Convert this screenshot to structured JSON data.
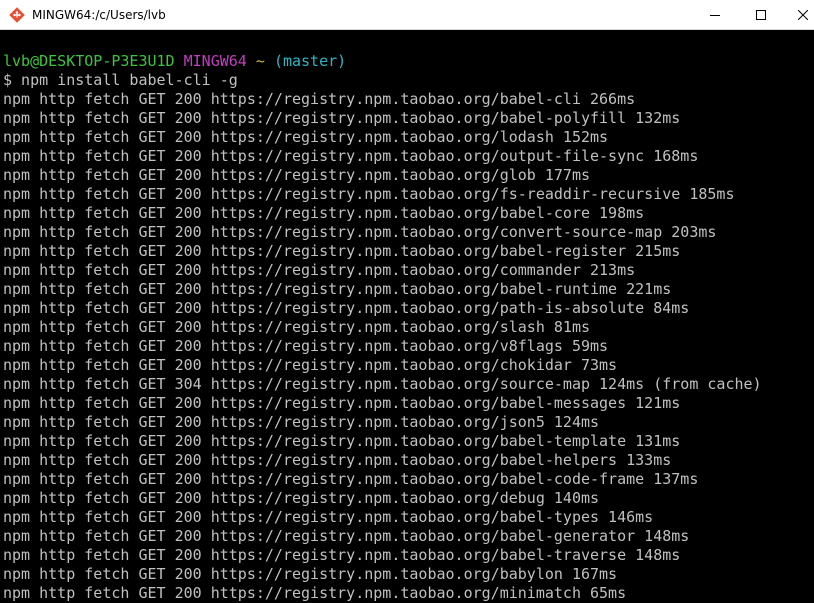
{
  "window": {
    "title": "MINGW64:/c/Users/lvb",
    "icon": "git-bash-icon",
    "controls": {
      "minimize": "minimize-icon",
      "maximize": "maximize-icon",
      "close": "close-icon"
    }
  },
  "colors": {
    "background": "#000000",
    "text": "#c0c0c0",
    "user_host": "#3ec53e",
    "shell_name": "#c33cc3",
    "directory": "#c8b93a",
    "branch": "#28b8c8"
  },
  "prompt": {
    "user_host": "lvb@DESKTOP-P3E3U1D",
    "shell": "MINGW64",
    "directory": "~",
    "branch": "(master)"
  },
  "command": "$ npm install babel-cli -g",
  "output": [
    "npm http fetch GET 200 https://registry.npm.taobao.org/babel-cli 266ms",
    "npm http fetch GET 200 https://registry.npm.taobao.org/babel-polyfill 132ms",
    "npm http fetch GET 200 https://registry.npm.taobao.org/lodash 152ms",
    "npm http fetch GET 200 https://registry.npm.taobao.org/output-file-sync 168ms",
    "npm http fetch GET 200 https://registry.npm.taobao.org/glob 177ms",
    "npm http fetch GET 200 https://registry.npm.taobao.org/fs-readdir-recursive 185ms",
    "npm http fetch GET 200 https://registry.npm.taobao.org/babel-core 198ms",
    "npm http fetch GET 200 https://registry.npm.taobao.org/convert-source-map 203ms",
    "npm http fetch GET 200 https://registry.npm.taobao.org/babel-register 215ms",
    "npm http fetch GET 200 https://registry.npm.taobao.org/commander 213ms",
    "npm http fetch GET 200 https://registry.npm.taobao.org/babel-runtime 221ms",
    "npm http fetch GET 200 https://registry.npm.taobao.org/path-is-absolute 84ms",
    "npm http fetch GET 200 https://registry.npm.taobao.org/slash 81ms",
    "npm http fetch GET 200 https://registry.npm.taobao.org/v8flags 59ms",
    "npm http fetch GET 200 https://registry.npm.taobao.org/chokidar 73ms",
    "npm http fetch GET 304 https://registry.npm.taobao.org/source-map 124ms (from cache)",
    "npm http fetch GET 200 https://registry.npm.taobao.org/babel-messages 121ms",
    "npm http fetch GET 200 https://registry.npm.taobao.org/json5 124ms",
    "npm http fetch GET 200 https://registry.npm.taobao.org/babel-template 131ms",
    "npm http fetch GET 200 https://registry.npm.taobao.org/babel-helpers 133ms",
    "npm http fetch GET 200 https://registry.npm.taobao.org/babel-code-frame 137ms",
    "npm http fetch GET 200 https://registry.npm.taobao.org/debug 140ms",
    "npm http fetch GET 200 https://registry.npm.taobao.org/babel-types 146ms",
    "npm http fetch GET 200 https://registry.npm.taobao.org/babel-generator 148ms",
    "npm http fetch GET 200 https://registry.npm.taobao.org/babel-traverse 148ms",
    "npm http fetch GET 200 https://registry.npm.taobao.org/babylon 167ms",
    "npm http fetch GET 200 https://registry.npm.taobao.org/minimatch 65ms"
  ]
}
